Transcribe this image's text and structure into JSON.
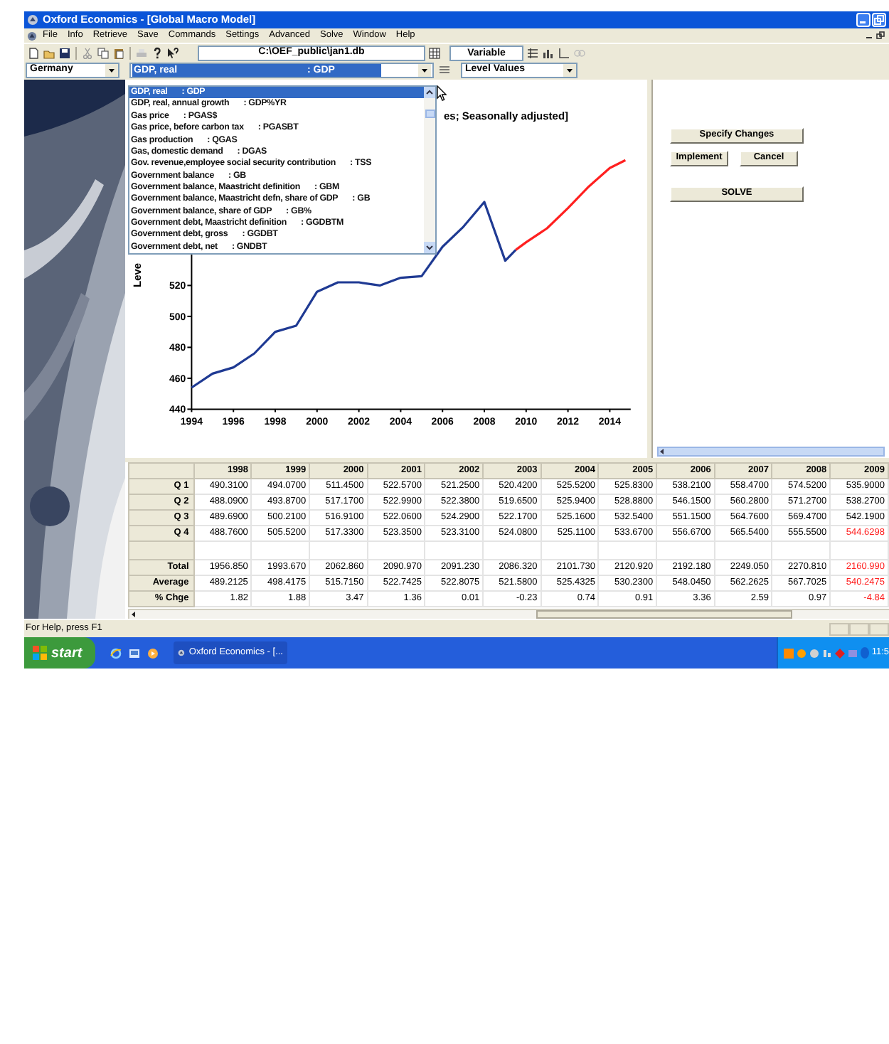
{
  "window": {
    "title": "Oxford Economics - [Global Macro Model]"
  },
  "menu": [
    "File",
    "Info",
    "Retrieve",
    "Save",
    "Commands",
    "Settings",
    "Advanced",
    "Solve",
    "Window",
    "Help"
  ],
  "toolbar": {
    "database": "C:\\OEF_public\\jan1.db",
    "variable_button": "Variable"
  },
  "selectors": {
    "country": "Germany",
    "variable": {
      "label": "GDP, real",
      "code": ": GDP"
    },
    "view": "Level Values"
  },
  "variable_list": {
    "items": [
      {
        "label": "GDP, real",
        "code": ": GDP",
        "selected": true
      },
      {
        "label": "GDP, real, annual growth",
        "code": ": GDP%YR",
        "selected": false
      },
      {
        "label": "Gas price",
        "code": ": PGAS$",
        "selected": false
      },
      {
        "label": "Gas price, before carbon tax",
        "code": ": PGASBT",
        "selected": false
      },
      {
        "label": "Gas production",
        "code": ": QGAS",
        "selected": false
      },
      {
        "label": "Gas, domestic demand",
        "code": ": DGAS",
        "selected": false
      },
      {
        "label": "Gov. revenue,employee social security contribution",
        "code": ": TSS",
        "selected": false
      },
      {
        "label": "Government balance",
        "code": ": GB",
        "selected": false
      },
      {
        "label": "Government balance, Maastricht definition",
        "code": ": GBM",
        "selected": false
      },
      {
        "label": "Government balance, Maastricht defn, share of GDP",
        "code": ": GB",
        "selected": false
      },
      {
        "label": "Government balance, share of GDP",
        "code": ": GB%",
        "selected": false
      },
      {
        "label": "Government debt, Maastricht definition",
        "code": ": GGDBTM",
        "selected": false
      },
      {
        "label": "Government debt, gross",
        "code": ": GGDBT",
        "selected": false
      },
      {
        "label": "Government debt, net",
        "code": ": GNDBT",
        "selected": false
      }
    ]
  },
  "chart": {
    "chart_data": {
      "type": "line",
      "title": "es; Seasonally adjusted]",
      "ylabel": "Leve",
      "x": [
        1994,
        1995,
        1996,
        1997,
        1998,
        1999,
        2000,
        2001,
        2002,
        2003,
        2004,
        2005,
        2006,
        2007,
        2008,
        2009,
        2009.5,
        2010,
        2011,
        2012,
        2013,
        2014,
        2014.75
      ],
      "series": [
        {
          "color": "#1f3a93",
          "values": [
            454,
            463,
            467,
            476,
            490,
            494,
            516,
            522,
            522,
            520,
            525,
            526,
            545,
            558,
            574,
            536,
            543,
            null,
            null,
            null,
            null,
            null,
            null
          ]
        },
        {
          "color": "#ff2020",
          "values": [
            null,
            null,
            null,
            null,
            null,
            null,
            null,
            null,
            null,
            null,
            null,
            null,
            null,
            null,
            null,
            null,
            543,
            548,
            557,
            570,
            584,
            596,
            601
          ]
        }
      ],
      "xlim": [
        1994,
        2015
      ],
      "ylim": [
        440,
        620
      ],
      "xticks": [
        1994,
        1996,
        1998,
        2000,
        2002,
        2004,
        2006,
        2008,
        2010,
        2012,
        2014
      ],
      "yticks": [
        440,
        460,
        480,
        500,
        520
      ]
    }
  },
  "actions": {
    "buttons": [
      "Specify Changes",
      "Implement",
      "Cancel",
      "SOLVE"
    ]
  },
  "table": {
    "columns": [
      "1998",
      "1999",
      "2000",
      "2001",
      "2002",
      "2003",
      "2004",
      "2005",
      "2006",
      "2007",
      "2008",
      "2009"
    ],
    "rows": [
      {
        "kind": "data",
        "label": "Q 1",
        "cells": [
          {
            "value": "490.3100",
            "forecast": false
          },
          {
            "value": "494.0700",
            "forecast": false
          },
          {
            "value": "511.4500",
            "forecast": false
          },
          {
            "value": "522.5700",
            "forecast": false
          },
          {
            "value": "521.2500",
            "forecast": false
          },
          {
            "value": "520.4200",
            "forecast": false
          },
          {
            "value": "525.5200",
            "forecast": false
          },
          {
            "value": "525.8300",
            "forecast": false
          },
          {
            "value": "538.2100",
            "forecast": false
          },
          {
            "value": "558.4700",
            "forecast": false
          },
          {
            "value": "574.5200",
            "forecast": false
          },
          {
            "value": "535.9000",
            "forecast": false
          }
        ]
      },
      {
        "kind": "data",
        "label": "Q 2",
        "cells": [
          {
            "value": "488.0900",
            "forecast": false
          },
          {
            "value": "493.8700",
            "forecast": false
          },
          {
            "value": "517.1700",
            "forecast": false
          },
          {
            "value": "522.9900",
            "forecast": false
          },
          {
            "value": "522.3800",
            "forecast": false
          },
          {
            "value": "519.6500",
            "forecast": false
          },
          {
            "value": "525.9400",
            "forecast": false
          },
          {
            "value": "528.8800",
            "forecast": false
          },
          {
            "value": "546.1500",
            "forecast": false
          },
          {
            "value": "560.2800",
            "forecast": false
          },
          {
            "value": "571.2700",
            "forecast": false
          },
          {
            "value": "538.2700",
            "forecast": false
          }
        ]
      },
      {
        "kind": "data",
        "label": "Q 3",
        "cells": [
          {
            "value": "489.6900",
            "forecast": false
          },
          {
            "value": "500.2100",
            "forecast": false
          },
          {
            "value": "516.9100",
            "forecast": false
          },
          {
            "value": "522.0600",
            "forecast": false
          },
          {
            "value": "524.2900",
            "forecast": false
          },
          {
            "value": "522.1700",
            "forecast": false
          },
          {
            "value": "525.1600",
            "forecast": false
          },
          {
            "value": "532.5400",
            "forecast": false
          },
          {
            "value": "551.1500",
            "forecast": false
          },
          {
            "value": "564.7600",
            "forecast": false
          },
          {
            "value": "569.4700",
            "forecast": false
          },
          {
            "value": "542.1900",
            "forecast": false
          }
        ]
      },
      {
        "kind": "data",
        "label": "Q 4",
        "cells": [
          {
            "value": "488.7600",
            "forecast": false
          },
          {
            "value": "505.5200",
            "forecast": false
          },
          {
            "value": "517.3300",
            "forecast": false
          },
          {
            "value": "523.3500",
            "forecast": false
          },
          {
            "value": "523.3100",
            "forecast": false
          },
          {
            "value": "524.0800",
            "forecast": false
          },
          {
            "value": "525.1100",
            "forecast": false
          },
          {
            "value": "533.6700",
            "forecast": false
          },
          {
            "value": "556.6700",
            "forecast": false
          },
          {
            "value": "565.5400",
            "forecast": false
          },
          {
            "value": "555.5500",
            "forecast": false
          },
          {
            "value": "544.6298",
            "forecast": true
          }
        ]
      },
      {
        "kind": "spacer"
      },
      {
        "kind": "data",
        "label": "Total",
        "cells": [
          {
            "value": "1956.850",
            "forecast": false
          },
          {
            "value": "1993.670",
            "forecast": false
          },
          {
            "value": "2062.860",
            "forecast": false
          },
          {
            "value": "2090.970",
            "forecast": false
          },
          {
            "value": "2091.230",
            "forecast": false
          },
          {
            "value": "2086.320",
            "forecast": false
          },
          {
            "value": "2101.730",
            "forecast": false
          },
          {
            "value": "2120.920",
            "forecast": false
          },
          {
            "value": "2192.180",
            "forecast": false
          },
          {
            "value": "2249.050",
            "forecast": false
          },
          {
            "value": "2270.810",
            "forecast": false
          },
          {
            "value": "2160.990",
            "forecast": true
          }
        ]
      },
      {
        "kind": "data",
        "label": "Average",
        "cells": [
          {
            "value": "489.2125",
            "forecast": false
          },
          {
            "value": "498.4175",
            "forecast": false
          },
          {
            "value": "515.7150",
            "forecast": false
          },
          {
            "value": "522.7425",
            "forecast": false
          },
          {
            "value": "522.8075",
            "forecast": false
          },
          {
            "value": "521.5800",
            "forecast": false
          },
          {
            "value": "525.4325",
            "forecast": false
          },
          {
            "value": "530.2300",
            "forecast": false
          },
          {
            "value": "548.0450",
            "forecast": false
          },
          {
            "value": "562.2625",
            "forecast": false
          },
          {
            "value": "567.7025",
            "forecast": false
          },
          {
            "value": "540.2475",
            "forecast": true
          }
        ]
      },
      {
        "kind": "data",
        "label": "% Chge",
        "cells": [
          {
            "value": "1.82",
            "forecast": false
          },
          {
            "value": "1.88",
            "forecast": false
          },
          {
            "value": "3.47",
            "forecast": false
          },
          {
            "value": "1.36",
            "forecast": false
          },
          {
            "value": "0.01",
            "forecast": false
          },
          {
            "value": "-0.23",
            "forecast": false
          },
          {
            "value": "0.74",
            "forecast": false
          },
          {
            "value": "0.91",
            "forecast": false
          },
          {
            "value": "3.36",
            "forecast": false
          },
          {
            "value": "2.59",
            "forecast": false
          },
          {
            "value": "0.97",
            "forecast": false
          },
          {
            "value": "-4.84",
            "forecast": true
          }
        ]
      }
    ]
  },
  "status_bar": "For Help, press F1",
  "taskbar": {
    "start": "start",
    "tasks": [
      "Oxford Economics - [..."
    ],
    "clock": "11:5"
  }
}
